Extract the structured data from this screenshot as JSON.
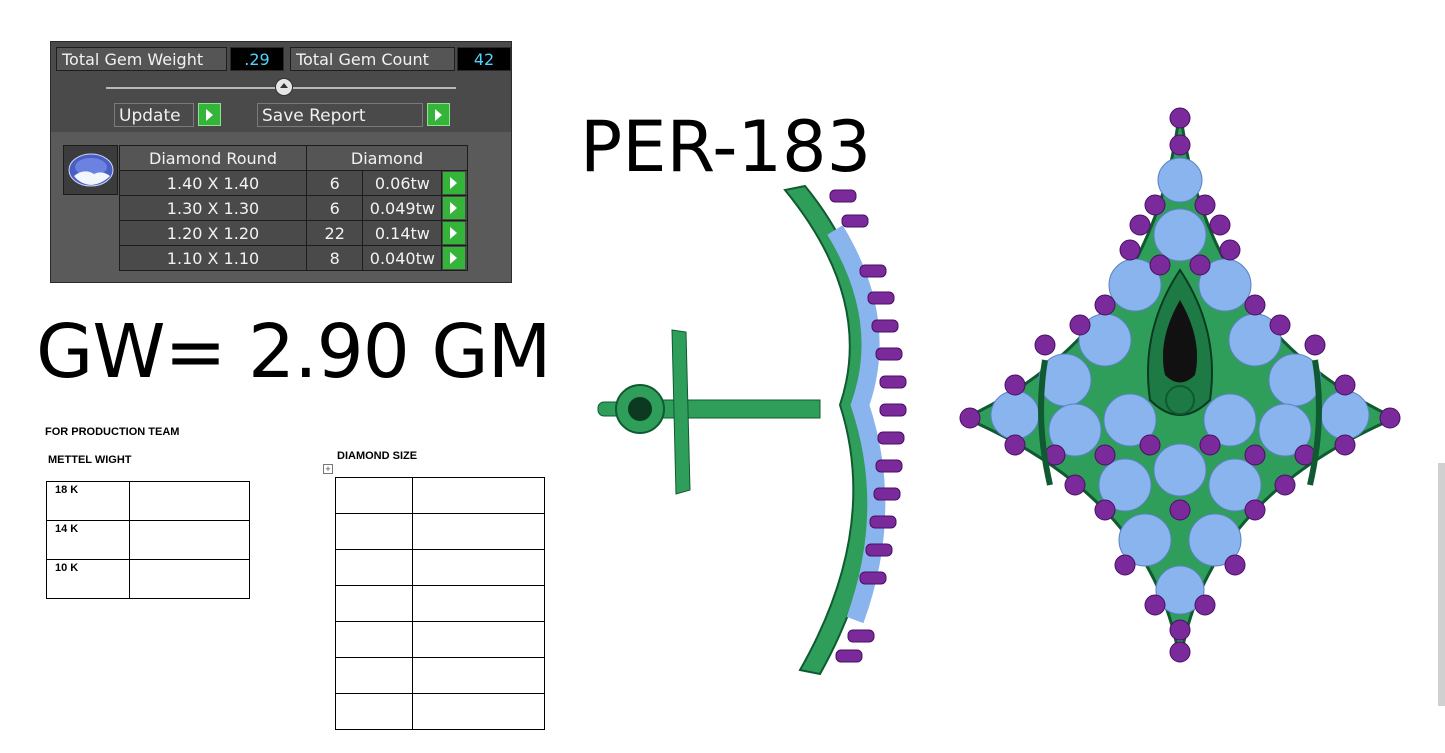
{
  "gem_panel": {
    "total_weight_label": "Total Gem Weight",
    "total_weight_value": ".29",
    "total_count_label": "Total Gem Count",
    "total_count_value": "42",
    "update_label": "Update",
    "save_report_label": "Save Report",
    "table_header_shape": "Diamond Round",
    "table_header_type": "Diamond",
    "rows": [
      {
        "size": "1.40 X 1.40",
        "count": "6",
        "weight": "0.06tw"
      },
      {
        "size": "1.30 X 1.30",
        "count": "6",
        "weight": "0.049tw"
      },
      {
        "size": "1.20 X 1.20",
        "count": "22",
        "weight": "0.14tw"
      },
      {
        "size": "1.10 X 1.10",
        "count": "8",
        "weight": "0.040tw"
      }
    ]
  },
  "gross_weight": "GW= 2.90 GM",
  "design_code": "PER-183",
  "production": {
    "heading": "FOR PRODUCTION TEAM",
    "metal_heading": "METTEL WIGHT",
    "metal_rows": [
      "18 K",
      "14 K",
      "10 K"
    ],
    "diamond_heading": "DIAMOND SIZE"
  },
  "colors": {
    "metal_green": "#2e9e5a",
    "gem_blue": "#8ab4ee",
    "prong_purple": "#7a2a9a",
    "panel_bg": "#5a5a5a",
    "value_cyan": "#4fd4ff",
    "button_green": "#34b53a"
  }
}
